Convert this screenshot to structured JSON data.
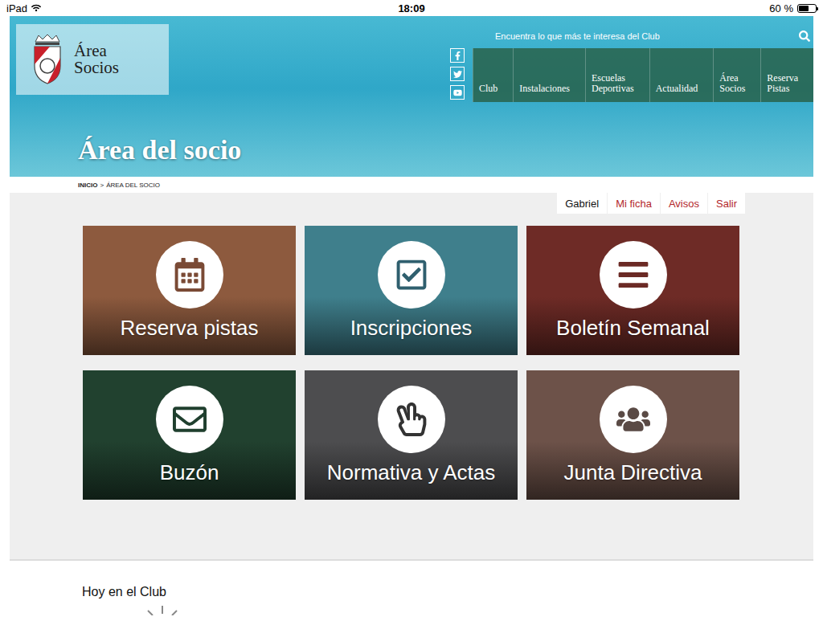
{
  "status_bar": {
    "device": "iPad",
    "time": "18:09",
    "battery": "60 %",
    "battery_level": 0.6
  },
  "header": {
    "logo_lines": [
      "Área",
      "Socios"
    ],
    "tagline": "Encuentra lo que más te interesa del Club",
    "nav": [
      {
        "lines": [
          "Club"
        ]
      },
      {
        "lines": [
          "Instalaciones"
        ]
      },
      {
        "lines": [
          "Escuelas",
          "Deportivas"
        ]
      },
      {
        "lines": [
          "Actualidad"
        ]
      },
      {
        "lines": [
          "Área",
          "Socios"
        ]
      },
      {
        "lines": [
          "Reserva",
          "Pistas"
        ]
      }
    ],
    "title": "Área del socio"
  },
  "breadcrumb": {
    "items": [
      "INICIO",
      "ÁREA DEL SOCIO"
    ],
    "separator": ">"
  },
  "user_menu": [
    {
      "label": "Gabriel",
      "kind": "name"
    },
    {
      "label": "Mi ficha",
      "kind": "link"
    },
    {
      "label": "Avisos",
      "kind": "link"
    },
    {
      "label": "Salir",
      "kind": "link"
    }
  ],
  "tiles": [
    {
      "label": "Reserva pistas"
    },
    {
      "label": "Inscripciones"
    },
    {
      "label": "Boletín Semanal"
    },
    {
      "label": "Buzón"
    },
    {
      "label": "Normativa y Actas"
    },
    {
      "label": "Junta Directiva"
    }
  ],
  "section": {
    "title": "Hoy en el Club"
  }
}
